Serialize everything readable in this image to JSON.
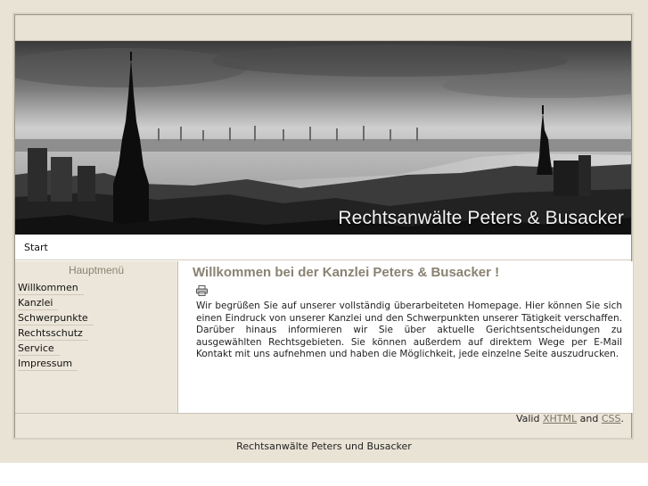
{
  "banner": {
    "title": "Rechtsanwälte Peters & Busacker"
  },
  "breadcrumb": {
    "label": "Start"
  },
  "sidebar": {
    "heading": "Hauptmenü",
    "items": [
      {
        "label": "Willkommen"
      },
      {
        "label": "Kanzlei"
      },
      {
        "label": "Schwerpunkte"
      },
      {
        "label": "Rechtsschutz"
      },
      {
        "label": "Service"
      },
      {
        "label": "Impressum"
      }
    ]
  },
  "content": {
    "heading": "Willkommen bei der Kanzlei Peters & Busacker !",
    "print_icon": "printer-icon",
    "body": "Wir begrüßen Sie auf unserer vollständig überarbeiteten Homepage. Hier können Sie sich einen Eindruck von unserer Kanzlei und den Schwerpunkten unserer Tätigkeit verschaffen. Darüber hinaus informieren wir Sie über aktuelle Gerichtsentscheidungen zu ausgewählten Rechtsgebieten. Sie können außerdem auf direktem Wege per E-Mail Kontakt mit uns aufnehmen und haben die Möglichkeit, jede einzelne Seite auszudrucken."
  },
  "footer": {
    "valid_prefix": "Valid",
    "xhtml_link": "XHTML",
    "and_text": "and",
    "css_link": "CSS",
    "period": ".",
    "bottom_text": "Rechtsanwälte Peters und Busacker"
  },
  "colors": {
    "background": "#e9e3d6",
    "sidebar": "#ece6da",
    "heading": "#8a8272"
  }
}
